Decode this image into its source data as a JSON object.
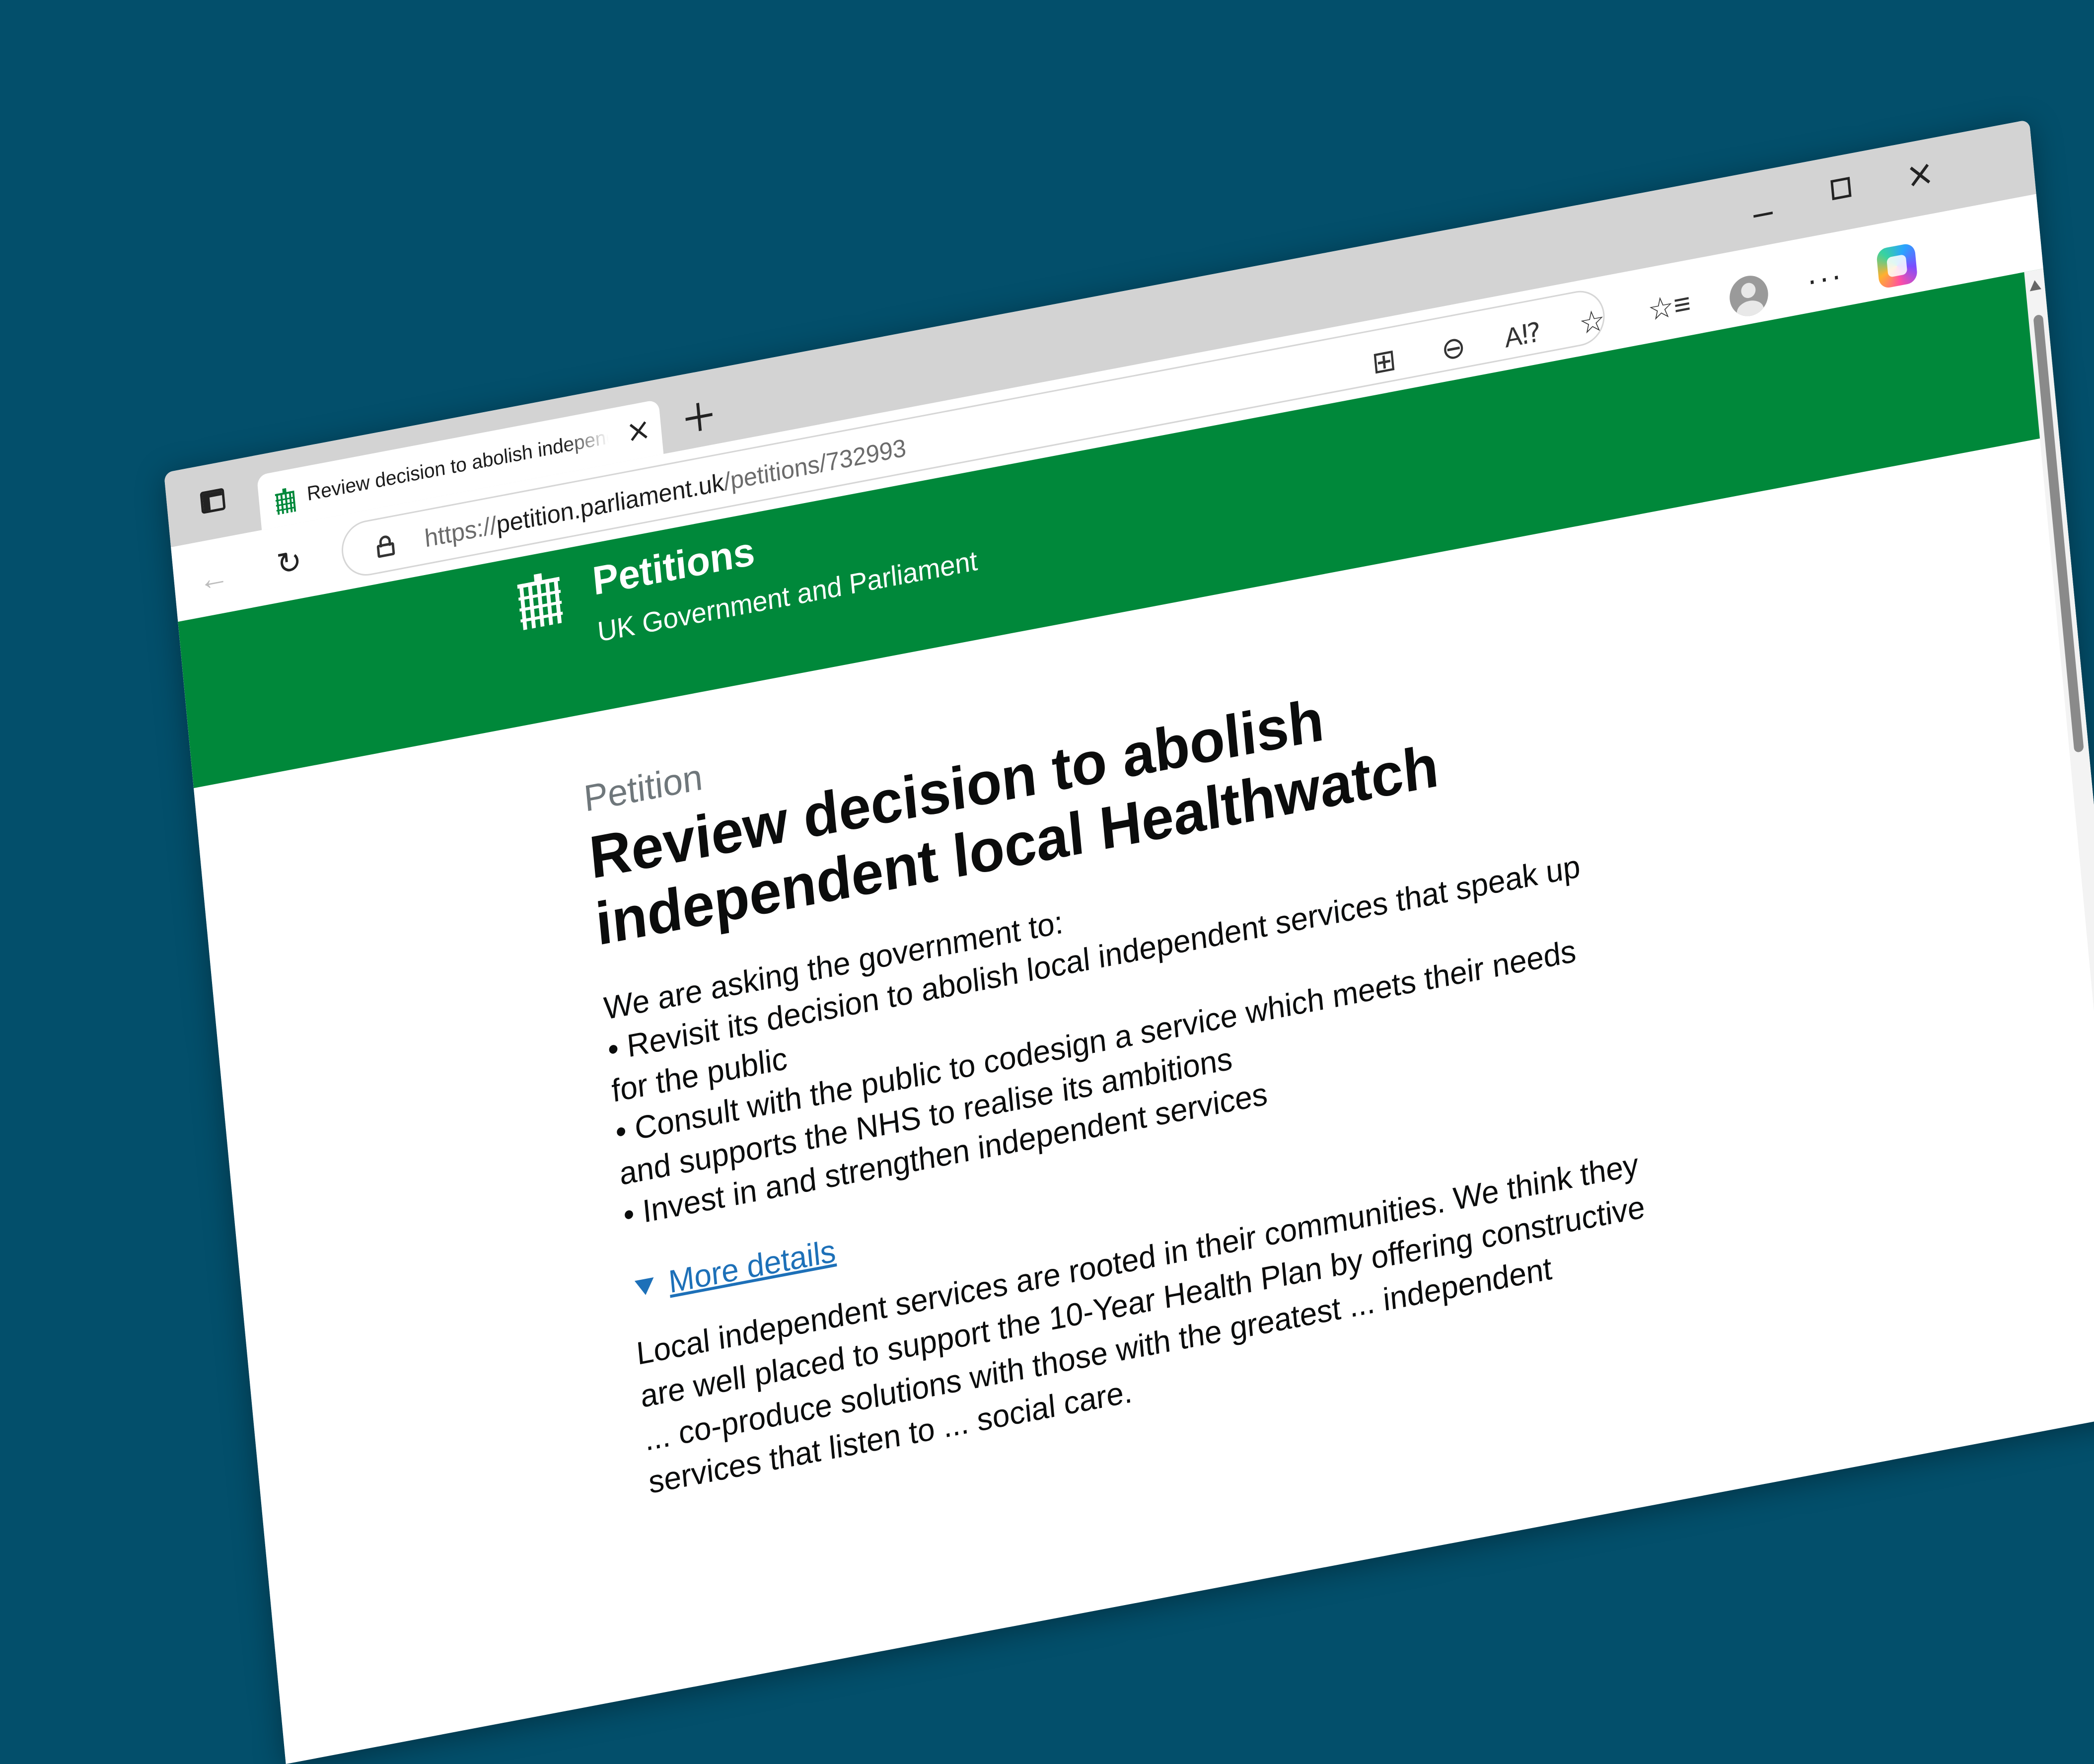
{
  "browser": {
    "tab": {
      "title": "Review decision to abolish independent local Healthwatch",
      "favicon": "portcullis-icon"
    },
    "address": {
      "scheme": "https://",
      "host": "petition.parliament.uk",
      "path": "/petitions/732993"
    },
    "toolbar_icons": [
      "back-icon",
      "reload-icon",
      "lock-icon",
      "grid-icon",
      "zoom-out-icon",
      "read-aloud-icon",
      "favorite-star-icon",
      "favorites-list-icon",
      "profile-avatar",
      "more-icon",
      "copilot-icon"
    ],
    "window_controls": [
      "minimize",
      "maximize",
      "close"
    ]
  },
  "site": {
    "title": "Petitions",
    "subtitle": "UK Government and Parliament",
    "header_color": "#00883a"
  },
  "petition": {
    "kicker": "Petition",
    "title": "Review decision to abolish independent local Healthwatch",
    "ask_intro": "We are asking the government to:",
    "bullets": [
      "• Revisit its decision to abolish local independent services that speak up for the public",
      "• Consult with the public to codesign a service which meets their needs and supports the NHS to realise its ambitions",
      "• Invest in and strengthen independent services"
    ],
    "more_details": "More details",
    "details_text": "Local independent services are rooted in their communities. We think they are well placed to support the 10-Year Health Plan by offering constructive ... co-produce solutions with those with the greatest ... independent services that listen to ... social care."
  },
  "colors": {
    "background": "#034f6b",
    "link": "#1d70b8",
    "kicker": "#6f777b"
  }
}
